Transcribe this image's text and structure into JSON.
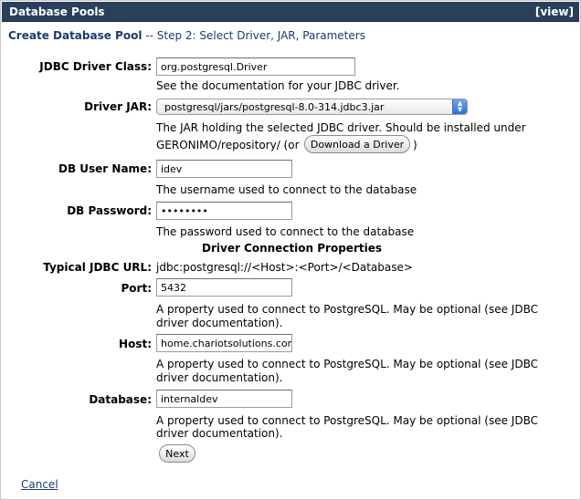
{
  "panel": {
    "title": "Database Pools",
    "view_link": "[view]"
  },
  "heading": {
    "link": "Create Database Pool",
    "step": " -- Step 2: Select Driver, JAR, Parameters"
  },
  "form": {
    "driver_class_label": "JDBC Driver Class:",
    "driver_class_value": "org.postgresql.Driver",
    "driver_class_help": "See the documentation for your JDBC driver.",
    "driver_jar_label": "Driver JAR:",
    "driver_jar_value": "postgresql/jars/postgresql-8.0-314.jdbc3.jar",
    "driver_jar_help_1": "The JAR holding the selected JDBC driver. Should be installed under",
    "driver_jar_help_2a": "GERONIMO/repository/ (or",
    "download_button": "Download a Driver",
    "driver_jar_help_2b": ")",
    "user_label": "DB User Name:",
    "user_value": "idev",
    "user_help": "The username used to connect to the database",
    "password_label": "DB Password:",
    "password_value": "••••••••",
    "password_help": "The password used to connect to the database",
    "section_title": "Driver Connection Properties",
    "typical_url_label": "Typical JDBC URL:",
    "typical_url_value": "jdbc:postgresql://<Host>:<Port>/<Database>",
    "port_label": "Port:",
    "port_value": "5432",
    "port_help_1": "A property used to connect to PostgreSQL. May be optional (see JDBC",
    "port_help_2": "driver documentation).",
    "host_label": "Host:",
    "host_value": "home.chariotsolutions.com",
    "host_help_1": "A property used to connect to PostgreSQL. May be optional (see JDBC",
    "host_help_2": "driver documentation).",
    "database_label": "Database:",
    "database_value": "internaldev",
    "database_help_1": "A property used to connect to PostgreSQL. May be optional (see JDBC",
    "database_help_2": "driver documentation).",
    "next_button": "Next",
    "cancel_link": "Cancel"
  }
}
